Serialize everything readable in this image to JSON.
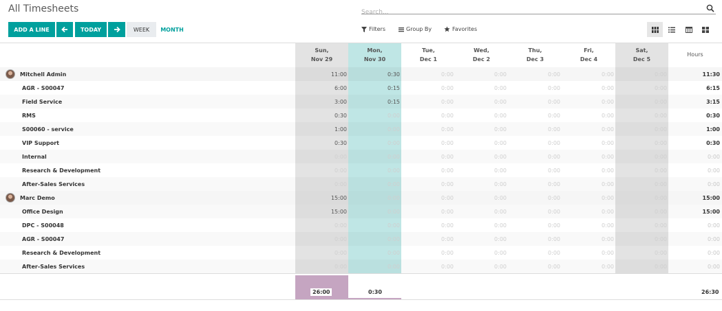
{
  "app": {
    "title": "All Timesheets"
  },
  "search": {
    "placeholder": "Search..."
  },
  "controls": {
    "add_line": "ADD A LINE",
    "today": "TODAY",
    "week": "WEEK",
    "month": "MONTH"
  },
  "filters": {
    "filters": "Filters",
    "group_by": "Group By",
    "favorites": "Favorites"
  },
  "columns": [
    {
      "day": "Sun,",
      "date": "Nov 29",
      "kind": "weekend"
    },
    {
      "day": "Mon,",
      "date": "Nov 30",
      "kind": "today"
    },
    {
      "day": "Tue,",
      "date": "Dec 1",
      "kind": "normal"
    },
    {
      "day": "Wed,",
      "date": "Dec 2",
      "kind": "normal"
    },
    {
      "day": "Thu,",
      "date": "Dec 3",
      "kind": "normal"
    },
    {
      "day": "Fri,",
      "date": "Dec 4",
      "kind": "normal"
    },
    {
      "day": "Sat,",
      "date": "Dec 5",
      "kind": "weekend"
    }
  ],
  "hours_header": "Hours",
  "rows": [
    {
      "type": "group",
      "label": "Mitchell Admin",
      "values": [
        "11:00",
        "0:30",
        "0:00",
        "0:00",
        "0:00",
        "0:00",
        "0:00"
      ],
      "total": "11:30"
    },
    {
      "type": "item",
      "label": "AGR - S00047",
      "values": [
        "6:00",
        "0:15",
        "0:00",
        "0:00",
        "0:00",
        "0:00",
        "0:00"
      ],
      "total": "6:15"
    },
    {
      "type": "item",
      "label": "Field Service",
      "values": [
        "3:00",
        "0:15",
        "0:00",
        "0:00",
        "0:00",
        "0:00",
        "0:00"
      ],
      "total": "3:15"
    },
    {
      "type": "item",
      "label": "RMS",
      "values": [
        "0:30",
        "0:00",
        "0:00",
        "0:00",
        "0:00",
        "0:00",
        "0:00"
      ],
      "total": "0:30"
    },
    {
      "type": "item",
      "label": "S00060 - service",
      "values": [
        "1:00",
        "0:00",
        "0:00",
        "0:00",
        "0:00",
        "0:00",
        "0:00"
      ],
      "total": "1:00"
    },
    {
      "type": "item",
      "label": "VIP Support",
      "values": [
        "0:30",
        "0:00",
        "0:00",
        "0:00",
        "0:00",
        "0:00",
        "0:00"
      ],
      "total": "0:30"
    },
    {
      "type": "item",
      "label": "Internal",
      "values": [
        "0:00",
        "0:00",
        "0:00",
        "0:00",
        "0:00",
        "0:00",
        "0:00"
      ],
      "total": "0:00"
    },
    {
      "type": "item",
      "label": "Research & Development",
      "values": [
        "0:00",
        "0:00",
        "0:00",
        "0:00",
        "0:00",
        "0:00",
        "0:00"
      ],
      "total": "0:00"
    },
    {
      "type": "item",
      "label": "After-Sales Services",
      "values": [
        "0:00",
        "0:00",
        "0:00",
        "0:00",
        "0:00",
        "0:00",
        "0:00"
      ],
      "total": "0:00"
    },
    {
      "type": "group",
      "label": "Marc Demo",
      "values": [
        "15:00",
        "0:00",
        "0:00",
        "0:00",
        "0:00",
        "0:00",
        "0:00"
      ],
      "total": "15:00"
    },
    {
      "type": "item",
      "label": "Office Design",
      "values": [
        "15:00",
        "0:00",
        "0:00",
        "0:00",
        "0:00",
        "0:00",
        "0:00"
      ],
      "total": "15:00"
    },
    {
      "type": "item",
      "label": "DPC - S00048",
      "values": [
        "0:00",
        "0:00",
        "0:00",
        "0:00",
        "0:00",
        "0:00",
        "0:00"
      ],
      "total": "0:00"
    },
    {
      "type": "item",
      "label": "AGR - S00047",
      "values": [
        "0:00",
        "0:00",
        "0:00",
        "0:00",
        "0:00",
        "0:00",
        "0:00"
      ],
      "total": "0:00"
    },
    {
      "type": "item",
      "label": "Research & Development",
      "values": [
        "0:00",
        "0:00",
        "0:00",
        "0:00",
        "0:00",
        "0:00",
        "0:00"
      ],
      "total": "0:00"
    },
    {
      "type": "item",
      "label": "After-Sales Services",
      "values": [
        "0:00",
        "0:00",
        "0:00",
        "0:00",
        "0:00",
        "0:00",
        "0:00"
      ],
      "total": "0:00"
    }
  ],
  "footer": {
    "sun_total": "26:00",
    "mon_total": "0:30",
    "grand_total": "26:30",
    "bar_fraction": [
      1.0,
      0.02
    ]
  },
  "colors": {
    "primary": "#00a09d",
    "today": "#bfe6e5",
    "weekend": "#e3e3e3",
    "bar": "#c5a5c1"
  }
}
